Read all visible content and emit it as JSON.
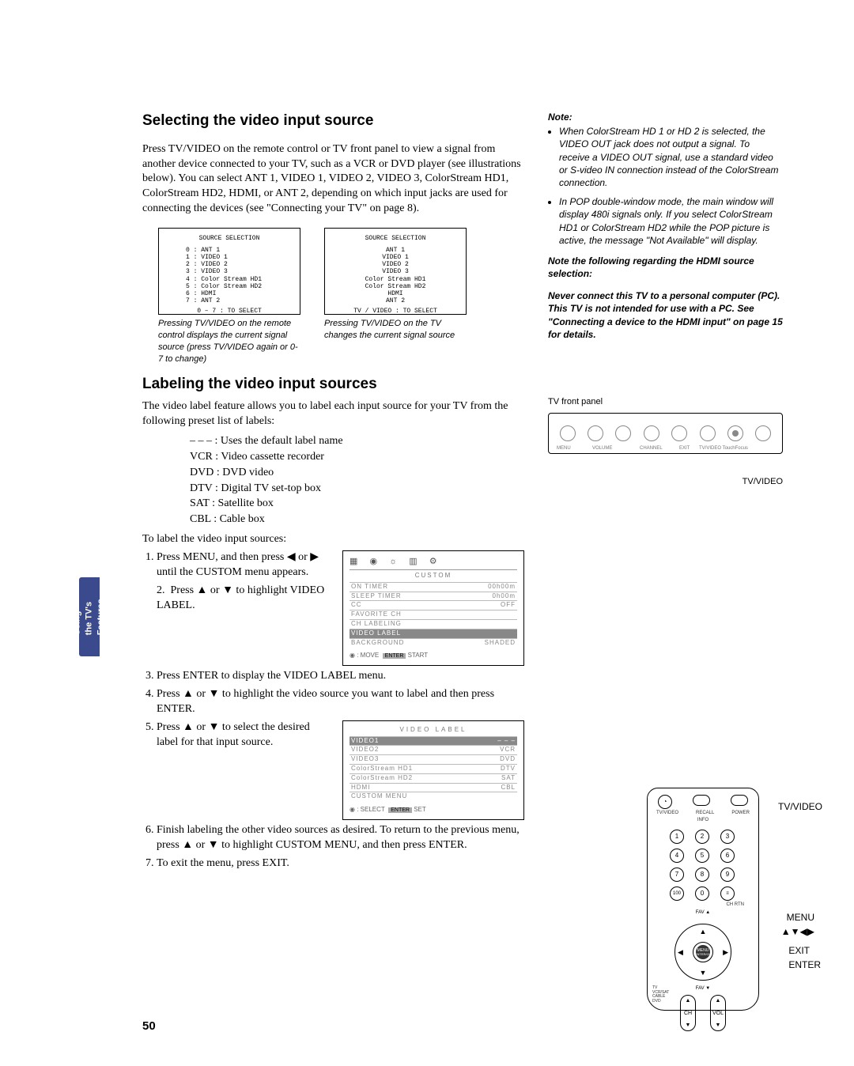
{
  "sideTab": "Using the TV's\nFeatures",
  "h1": "Selecting the video input source",
  "p1": "Press TV/VIDEO on the remote control or TV front panel to view a signal from another device connected to your TV, such as a VCR or DVD player (see illustrations below). You can select ANT 1, VIDEO 1, VIDEO 2, VIDEO 3, ColorStream HD1, ColorStream HD2, HDMI, or ANT 2, depending on which input jacks are used for connecting the devices (see \"Connecting your TV\" on page 8).",
  "osd": {
    "title": "SOURCE SELECTION",
    "left": {
      "items": [
        "0 : ANT 1",
        "1 : VIDEO 1",
        "2 : VIDEO 2",
        "3 : VIDEO 3",
        "4 : Color Stream HD1",
        "5 : Color Stream HD2",
        "6 : HDMI",
        "7 : ANT 2"
      ],
      "foot": "0 – 7 : TO SELECT",
      "cap": "Pressing TV/VIDEO on the remote control displays the current signal source (press TV/VIDEO again or 0-7 to change)"
    },
    "right": {
      "items": [
        "ANT 1",
        "VIDEO 1",
        "VIDEO 2",
        "VIDEO 3",
        "Color Stream HD1",
        "Color Stream HD2",
        "HDMI",
        "ANT 2"
      ],
      "foot": "TV / VIDEO : TO SELECT",
      "cap": "Pressing TV/VIDEO on the TV changes the current signal source"
    }
  },
  "note": {
    "h": "Note:",
    "b1": "When ColorStream HD 1 or HD 2 is selected, the VIDEO OUT jack does not output a signal. To receive a VIDEO OUT signal, use a standard video or S-video IN connection instead of the ColorStream connection.",
    "b2": "In POP double-window mode, the main window will display 480i signals only. If you select ColorStream HD1 or ColorStream HD2 while the POP picture is active, the message \"Not Available\" will display.",
    "h2": "Note the following regarding the HDMI source selection:",
    "p2": "Never connect this TV to a personal computer (PC). This TV is not intended for use with a PC. See \"Connecting a device to the HDMI input\" on page 15 for details."
  },
  "h2": "Labeling the video input sources",
  "p2": "The video label feature allows you to label each input source for your TV from the following preset list of labels:",
  "labels": {
    "l1": "– – –  : Uses the default label name",
    "l2": "VCR  : Video cassette recorder",
    "l3": "DVD  : DVD video",
    "l4": "DTV  : Digital TV set-top box",
    "l5": "SAT   : Satellite box",
    "l6": "CBL   : Cable box"
  },
  "p3": "To label the video input sources:",
  "steps": {
    "s1": "Press MENU, and then press ◀ or ▶ until the CUSTOM menu appears.",
    "s2": "Press ▲ or ▼ to highlight VIDEO LABEL.",
    "s3": "Press ENTER to display the VIDEO LABEL menu.",
    "s4": "Press ▲ or ▼ to highlight the video source you want to label and then press ENTER.",
    "s5": "Press ▲ or ▼ to select the desired label for that input source.",
    "s6": "Finish labeling the other video sources as desired. To return to the previous menu, press ▲ or ▼ to highlight CUSTOM MENU, and then press ENTER.",
    "s7": "To exit the menu, press EXIT."
  },
  "menu1": {
    "title": "CUSTOM",
    "rows": [
      [
        "ON TIMER",
        "00h00m"
      ],
      [
        "SLEEP TIMER",
        "0h00m"
      ],
      [
        "CC",
        "OFF"
      ],
      [
        "FAVORITE CH",
        ""
      ],
      [
        "CH LABELING",
        ""
      ]
    ],
    "hl": "VIDEO LABEL",
    "rows2": [
      [
        "BACKGROUND",
        "SHADED"
      ]
    ],
    "foot": [
      "◉ : MOVE",
      "ENTER",
      "START"
    ]
  },
  "menu2": {
    "title": "VIDEO LABEL",
    "rows": [
      [
        "VIDEO1",
        "– – –"
      ],
      [
        "VIDEO2",
        "VCR"
      ],
      [
        "VIDEO3",
        "DVD"
      ],
      [
        "ColorStream HD1",
        "DTV"
      ],
      [
        "ColorStream HD2",
        "SAT"
      ],
      [
        "HDMI",
        "CBL"
      ],
      [
        "CUSTOM MENU",
        ""
      ]
    ],
    "foot": [
      "◉ : SELECT",
      "ENTER",
      "SET"
    ]
  },
  "panel": {
    "cap": "TV front panel",
    "labels": [
      "MENU",
      "VOLUME",
      "CHANNEL",
      "EXIT",
      "TV/VIDEO TouchFocus"
    ],
    "callout": "TV/VIDEO"
  },
  "remote": {
    "top": [
      "TV/VIDEO",
      "RECALL",
      "POWER"
    ],
    "info": "INFO",
    "nums": [
      "1",
      "2",
      "3",
      "4",
      "5",
      "6",
      "7",
      "8",
      "9",
      "100",
      "0"
    ],
    "chrtn": "CH RTN",
    "fav": "FAV ▲",
    "fav2": "FAV ▼",
    "menu": "MENU",
    "enter": "ENTER/CH",
    "rockers": [
      "CH",
      "VOL"
    ],
    "callouts": {
      "tvv": "TV/VIDEO",
      "menu": "MENU",
      "arrows": "▲▼◀▶",
      "exit": "EXIT",
      "enter": "ENTER"
    },
    "mode": "TV\nVCR/SAT\nCABLE\nDVD"
  },
  "pageNum": "50"
}
